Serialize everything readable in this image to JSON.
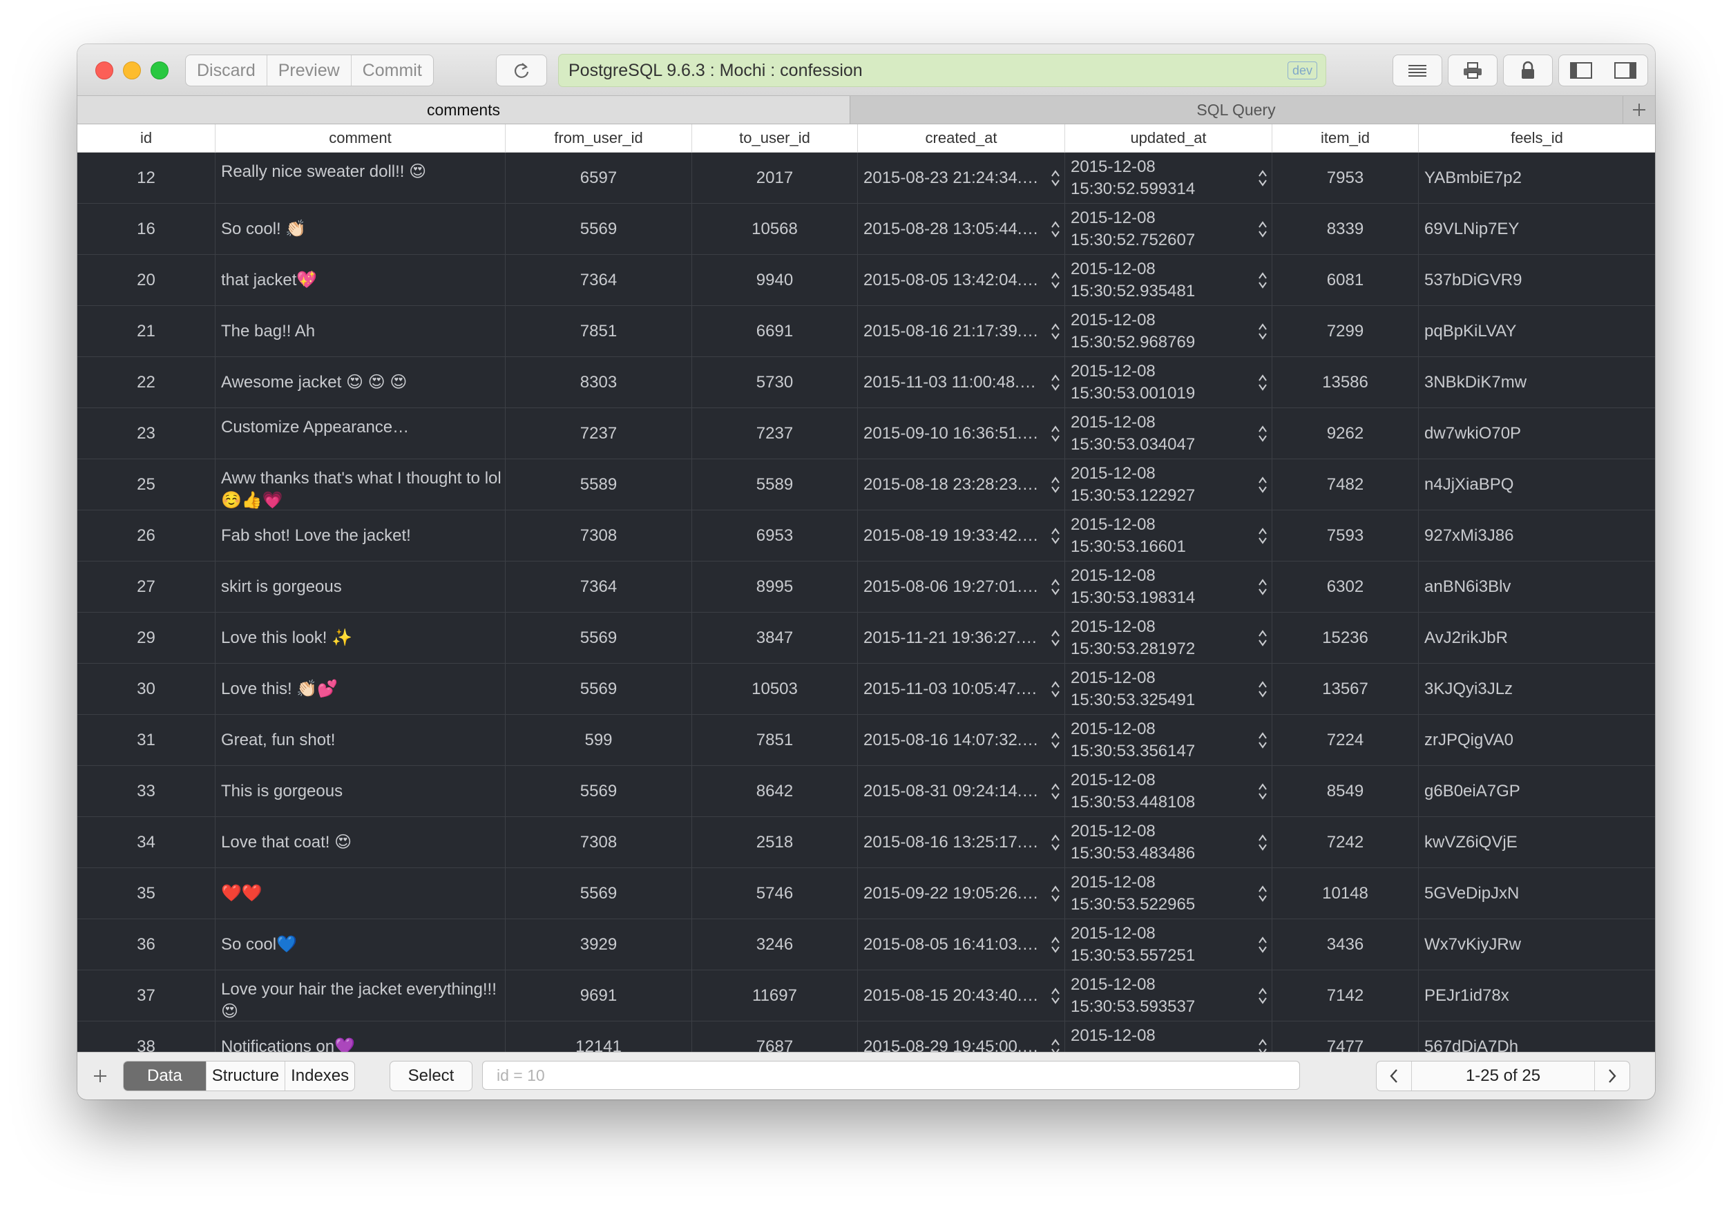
{
  "toolbar": {
    "buttons": [
      "Discard",
      "Preview",
      "Commit"
    ],
    "connection": "PostgreSQL 9.6.3 : Mochi : confession",
    "environment": "dev",
    "icons": [
      "refresh-icon",
      "list-icon",
      "print-icon",
      "lock-icon",
      "left-sidebar-icon",
      "right-sidebar-icon"
    ]
  },
  "tabs": [
    {
      "label": "comments",
      "active": true
    },
    {
      "label": "SQL Query",
      "active": false
    }
  ],
  "table": {
    "columns": [
      "id",
      "comment",
      "from_user_id",
      "to_user_id",
      "created_at",
      "updated_at",
      "item_id",
      "feels_id"
    ],
    "rows": [
      {
        "id": "12",
        "comment": "Really nice sweater doll!! 😍",
        "from_user_id": "6597",
        "to_user_id": "2017",
        "created_at": "2015-08-23 21:24:34.…",
        "updated_at": "2015-12-08 15:30:52.599314",
        "item_id": "7953",
        "feels_id": "YABmbiE7p2"
      },
      {
        "id": "16",
        "comment": "So cool! 👏🏻",
        "from_user_id": "5569",
        "to_user_id": "10568",
        "created_at": "2015-08-28 13:05:44.…",
        "updated_at": "2015-12-08 15:30:52.752607",
        "item_id": "8339",
        "feels_id": "69VLNip7EY"
      },
      {
        "id": "20",
        "comment": " that jacket💖",
        "from_user_id": "7364",
        "to_user_id": "9940",
        "created_at": "2015-08-05 13:42:04.…",
        "updated_at": "2015-12-08 15:30:52.935481",
        "item_id": "6081",
        "feels_id": "537bDiGVR9"
      },
      {
        "id": "21",
        "comment": "The bag!! Ah",
        "from_user_id": "7851",
        "to_user_id": "6691",
        "created_at": "2015-08-16 21:17:39.…",
        "updated_at": "2015-12-08 15:30:52.968769",
        "item_id": "7299",
        "feels_id": "pqBpKiLVAY"
      },
      {
        "id": "22",
        "comment": "Awesome jacket 😍 😍 😍",
        "from_user_id": "8303",
        "to_user_id": "5730",
        "created_at": "2015-11-03 11:00:48.…",
        "updated_at": "2015-12-08 15:30:53.001019",
        "item_id": "13586",
        "feels_id": "3NBkDiK7mw"
      },
      {
        "id": "23",
        "comment": "Customize Appearance…",
        "from_user_id": "7237",
        "to_user_id": "7237",
        "created_at": "2015-09-10 16:36:51.…",
        "updated_at": "2015-12-08 15:30:53.034047",
        "item_id": "9262",
        "feels_id": "dw7wkiO70P"
      },
      {
        "id": "25",
        "comment": "Aww thanks that's what I thought to lol ☺️👍💗",
        "from_user_id": "5589",
        "to_user_id": "5589",
        "created_at": "2015-08-18 23:28:23.…",
        "updated_at": "2015-12-08 15:30:53.122927",
        "item_id": "7482",
        "feels_id": "n4JjXiaBPQ"
      },
      {
        "id": "26",
        "comment": "Fab shot! Love the jacket!",
        "from_user_id": "7308",
        "to_user_id": "6953",
        "created_at": "2015-08-19 19:33:42.…",
        "updated_at": "2015-12-08 15:30:53.16601",
        "item_id": "7593",
        "feels_id": "927xMi3J86"
      },
      {
        "id": "27",
        "comment": "skirt is gorgeous",
        "from_user_id": "7364",
        "to_user_id": "8995",
        "created_at": "2015-08-06 19:27:01.…",
        "updated_at": "2015-12-08 15:30:53.198314",
        "item_id": "6302",
        "feels_id": "anBN6i3Blv"
      },
      {
        "id": "29",
        "comment": "Love this look! ✨",
        "from_user_id": "5569",
        "to_user_id": "3847",
        "created_at": "2015-11-21 19:36:27.1…",
        "updated_at": "2015-12-08 15:30:53.281972",
        "item_id": "15236",
        "feels_id": "AvJ2rikJbR"
      },
      {
        "id": "30",
        "comment": "Love this! 👏🏻💕",
        "from_user_id": "5569",
        "to_user_id": "10503",
        "created_at": "2015-11-03 10:05:47.…",
        "updated_at": "2015-12-08 15:30:53.325491",
        "item_id": "13567",
        "feels_id": "3KJQyi3JLz"
      },
      {
        "id": "31",
        "comment": "Great, fun shot!",
        "from_user_id": "599",
        "to_user_id": "7851",
        "created_at": "2015-08-16 14:07:32.…",
        "updated_at": "2015-12-08 15:30:53.356147",
        "item_id": "7224",
        "feels_id": "zrJPQigVA0"
      },
      {
        "id": "33",
        "comment": "This is gorgeous",
        "from_user_id": "5569",
        "to_user_id": "8642",
        "created_at": "2015-08-31 09:24:14.…",
        "updated_at": "2015-12-08 15:30:53.448108",
        "item_id": "8549",
        "feels_id": "g6B0eiA7GP"
      },
      {
        "id": "34",
        "comment": "Love that coat! 😍",
        "from_user_id": "7308",
        "to_user_id": "2518",
        "created_at": "2015-08-16 13:25:17.…",
        "updated_at": "2015-12-08 15:30:53.483486",
        "item_id": "7242",
        "feels_id": "kwVZ6iQVjE"
      },
      {
        "id": "35",
        "comment": "❤️❤️",
        "from_user_id": "5569",
        "to_user_id": "5746",
        "created_at": "2015-09-22 19:05:26.…",
        "updated_at": "2015-12-08 15:30:53.522965",
        "item_id": "10148",
        "feels_id": "5GVeDipJxN"
      },
      {
        "id": "36",
        "comment": "So cool💙",
        "from_user_id": "3929",
        "to_user_id": "3246",
        "created_at": "2015-08-05 16:41:03.…",
        "updated_at": "2015-12-08 15:30:53.557251",
        "item_id": "3436",
        "feels_id": "Wx7vKiyJRw"
      },
      {
        "id": "37",
        "comment": "Love your hair the jacket everything!!!😍",
        "from_user_id": "9691",
        "to_user_id": "11697",
        "created_at": "2015-08-15 20:43:40.…",
        "updated_at": "2015-12-08 15:30:53.593537",
        "item_id": "7142",
        "feels_id": "PEJr1id78x"
      },
      {
        "id": "38",
        "comment": "Notifications on💜",
        "from_user_id": "12141",
        "to_user_id": "7687",
        "created_at": "2015-08-29 19:45:00.…",
        "updated_at": "2015-12-08",
        "item_id": "7477",
        "feels_id": "567dDiA7Dh"
      }
    ]
  },
  "bottombar": {
    "views": [
      "Data",
      "Structure",
      "Indexes"
    ],
    "active_view": "Data",
    "select_label": "Select",
    "filter_placeholder": "id = 10",
    "filter_value": "",
    "pagination": "1-25 of 25"
  },
  "colors": {
    "grid_background": "#272a30",
    "grid_text": "#c9cbcf",
    "connection_bar": "#d7ebc3"
  }
}
